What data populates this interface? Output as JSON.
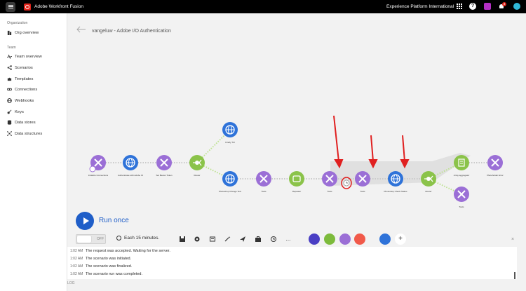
{
  "topbar": {
    "app_title": "Adobe Workfront Fusion",
    "org_name": "Experience Platform International",
    "notification_count": "4",
    "help_label": "?"
  },
  "sidebar": {
    "org_section": "Organization",
    "org_items": [
      {
        "label": "Org overview",
        "icon": "building-icon"
      }
    ],
    "team_section": "Team",
    "team_items": [
      {
        "label": "Team overview",
        "icon": "pulse-icon"
      },
      {
        "label": "Scenarios",
        "icon": "share-icon"
      },
      {
        "label": "Templates",
        "icon": "puzzle-icon"
      },
      {
        "label": "Connections",
        "icon": "link-icon"
      },
      {
        "label": "Webhooks",
        "icon": "globe-icon"
      },
      {
        "label": "Keys",
        "icon": "key-icon"
      },
      {
        "label": "Data stores",
        "icon": "database-icon"
      },
      {
        "label": "Data structures",
        "icon": "structure-icon"
      }
    ]
  },
  "main": {
    "scenario_title": "vangeluw - Adobe I/O Authentication",
    "run_label": "Run once",
    "toggle_label": "OFF",
    "schedule_label": "Each 15 minutes.",
    "more_label": "..."
  },
  "nodes": [
    {
      "label": "Initialize Connections",
      "sub": "Set multiple variables",
      "color": "#9b6fd6"
    },
    {
      "label": "Authenticate with Adobe IO",
      "sub": "Make a request",
      "color": "#2f73d9"
    },
    {
      "label": "Set Bearer Token",
      "sub": "Set multiple variables",
      "color": "#9b6fd6"
    },
    {
      "label": "Router",
      "sub": "",
      "color": "#8bc34a"
    },
    {
      "label": "Firefly T2I",
      "sub": "Make a request",
      "color": "#2f73d9"
    },
    {
      "label": "Photoshop Change Text",
      "sub": "Make a request",
      "color": "#2f73d9"
    },
    {
      "label": "Tools",
      "sub": "Set multiple variables",
      "color": "#9b6fd6"
    },
    {
      "label": "Repeater",
      "sub": "",
      "color": "#8bc34a"
    },
    {
      "label": "Tools",
      "sub": "Set multiple variables",
      "color": "#9b6fd6"
    },
    {
      "label": "Tools",
      "sub": "Sleep",
      "color": "#9b6fd6"
    },
    {
      "label": "Photoshop Check Status",
      "sub": "Make a request",
      "color": "#2f73d9"
    },
    {
      "label": "Router",
      "sub": "",
      "color": "#8bc34a"
    },
    {
      "label": "Array aggregator",
      "sub": "",
      "color": "#8bc34a"
    },
    {
      "label": "Tools",
      "sub": "Set multiple variables",
      "color": "#9b6fd6"
    },
    {
      "label": "Placeholder Error",
      "sub": "Set multiple variables",
      "color": "#9b6fd6"
    }
  ],
  "log": {
    "rows": [
      {
        "time": "1:02 AM",
        "text": "The request was accepted. Waiting for the server."
      },
      {
        "time": "1:02 AM",
        "text": "The scenario was initiated."
      },
      {
        "time": "1:02 AM",
        "text": "The scenario was finalized."
      },
      {
        "time": "1:02 AM",
        "text": "The scenario run was completed."
      }
    ],
    "label": "LOG",
    "close": "×"
  },
  "colors": {
    "accent": "#1f5ec8",
    "purple_module": "#9b6fd6",
    "blue_module": "#2f73d9",
    "green_module": "#8bc34a",
    "annotation": "#e02020"
  }
}
